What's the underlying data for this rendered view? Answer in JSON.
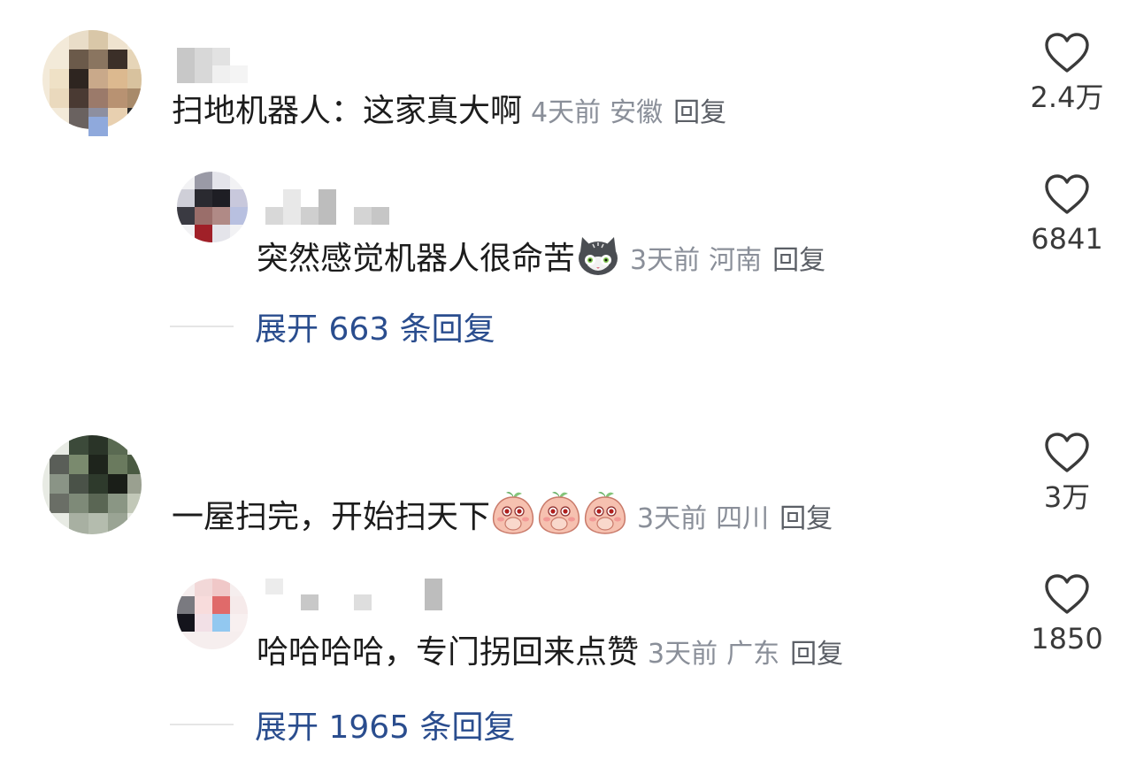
{
  "comments": [
    {
      "text": "扫地机器人：这家真大啊",
      "time": "4天前",
      "location": "安徽",
      "reply_label": "回复",
      "likes": "2.4万",
      "reply": {
        "text": "突然感觉机器人很命苦",
        "emoji": "cat-emoji",
        "time": "3天前",
        "location": "河南",
        "reply_label": "回复",
        "likes": "6841"
      },
      "expand_label": "展开 663 条回复"
    },
    {
      "text": "一屋扫完，开始扫天下",
      "emoji": "peach-covering-mouth-emoji",
      "time": "3天前",
      "location": "四川",
      "reply_label": "回复",
      "likes": "3万",
      "reply": {
        "text": "哈哈哈哈，专门拐回来点赞",
        "time": "3天前",
        "location": "广东",
        "reply_label": "回复",
        "likes": "1850"
      },
      "expand_label": "展开 1965 条回复"
    }
  ],
  "colors": {
    "text": "#1c1c1c",
    "meta": "#8a8f99",
    "link": "#2a4d8e",
    "icon": "#3a3a3a"
  }
}
